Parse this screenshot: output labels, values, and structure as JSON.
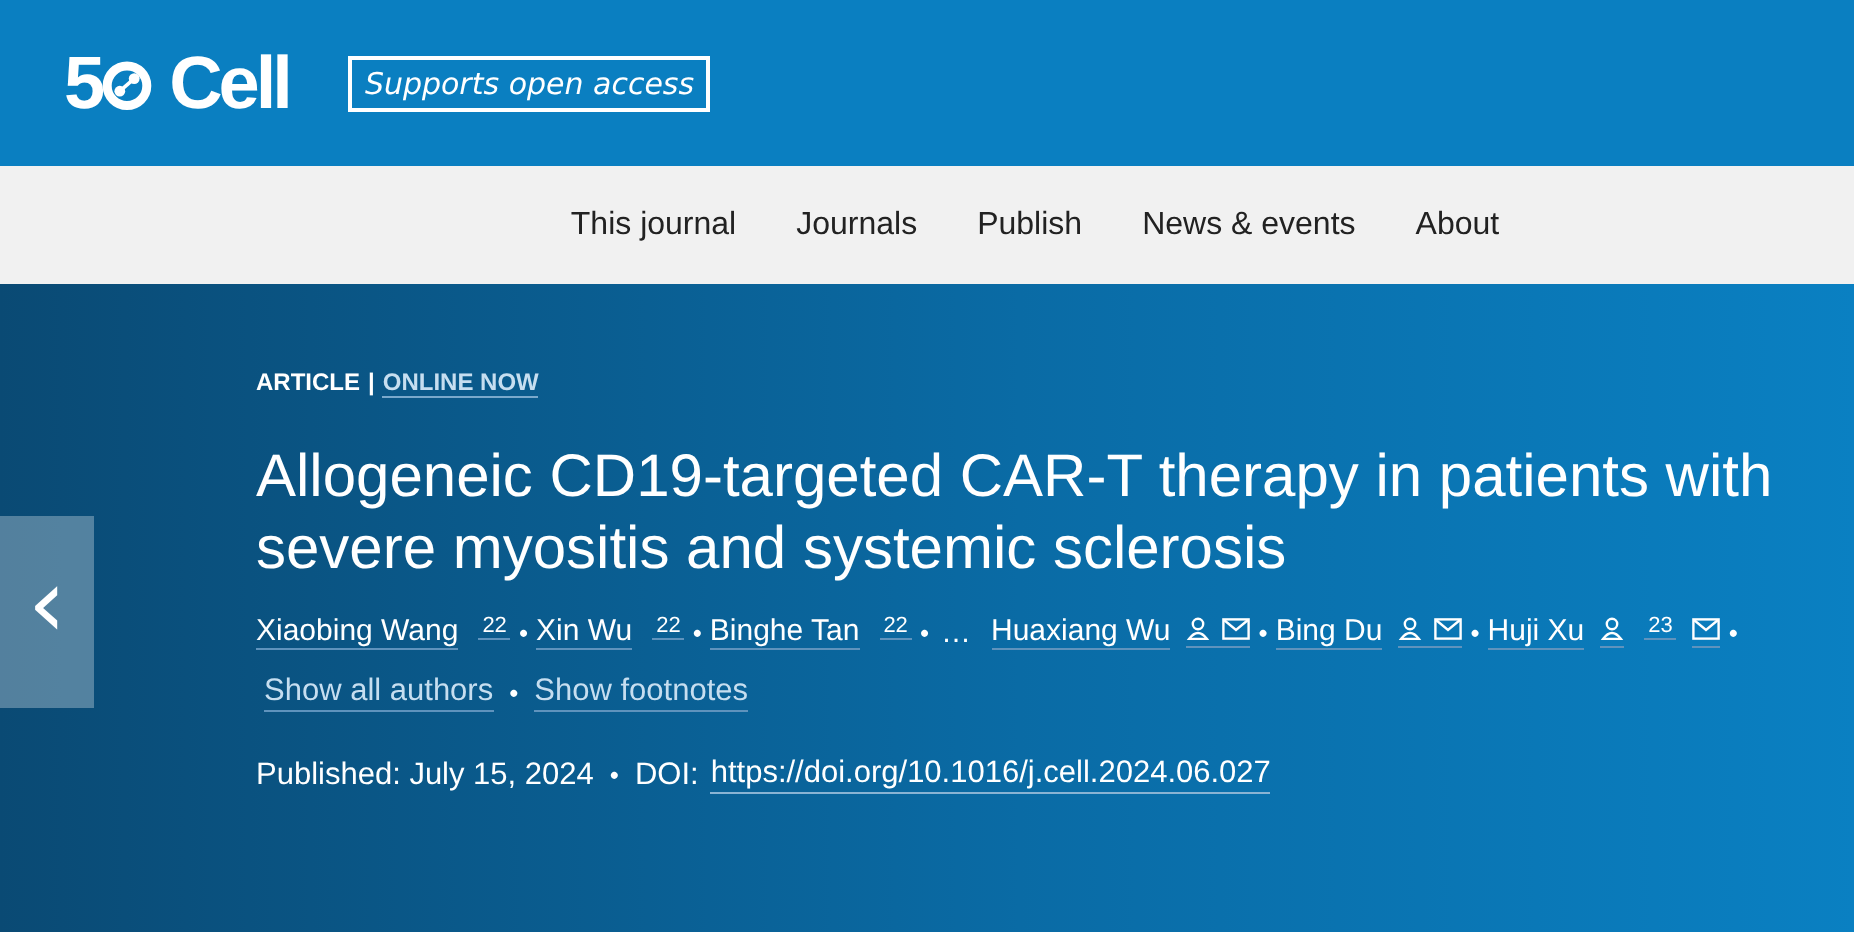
{
  "header": {
    "logo": {
      "digit": "5",
      "name": "Cell"
    },
    "badge": "Supports open access"
  },
  "nav": [
    {
      "label": "This journal"
    },
    {
      "label": "Journals"
    },
    {
      "label": "Publish"
    },
    {
      "label": "News & events"
    },
    {
      "label": "About"
    }
  ],
  "article": {
    "type": "ARTICLE",
    "divider": "|",
    "status": "ONLINE NOW",
    "title": "Allogeneic CD19-targeted CAR-T therapy in patients with severe myositis and systemic sclerosis",
    "authors": [
      {
        "kind": "author",
        "name": "Xiaobing Wang",
        "extras": [
          {
            "kind": "footnote",
            "text": "22"
          }
        ],
        "sep": "•"
      },
      {
        "kind": "author",
        "name": "Xin Wu",
        "extras": [
          {
            "kind": "footnote",
            "text": "22"
          }
        ],
        "sep": "•"
      },
      {
        "kind": "author",
        "name": "Binghe Tan",
        "extras": [
          {
            "kind": "footnote",
            "text": "22"
          }
        ],
        "sep": "•"
      },
      {
        "kind": "ellipsis",
        "name": "…"
      },
      {
        "kind": "author",
        "name": "Huaxiang Wu",
        "extras": [
          {
            "kind": "person"
          },
          {
            "kind": "mail"
          }
        ],
        "sep": "•"
      },
      {
        "kind": "author",
        "name": "Bing Du",
        "extras": [
          {
            "kind": "person"
          },
          {
            "kind": "mail"
          }
        ],
        "sep": "•"
      },
      {
        "kind": "author",
        "name": "Huji Xu",
        "extras": [
          {
            "kind": "person"
          },
          {
            "kind": "footnote",
            "text": "23"
          },
          {
            "kind": "mail"
          }
        ],
        "sep": "•"
      }
    ],
    "show_all": "Show all authors",
    "show_sep": "•",
    "show_footnotes": "Show footnotes",
    "published": "Published: July 15, 2024",
    "pub_sep": "•",
    "doi_label": "DOI:",
    "doi": "https://doi.org/10.1016/j.cell.2024.06.027"
  },
  "carousel": {
    "prev": "‹"
  }
}
